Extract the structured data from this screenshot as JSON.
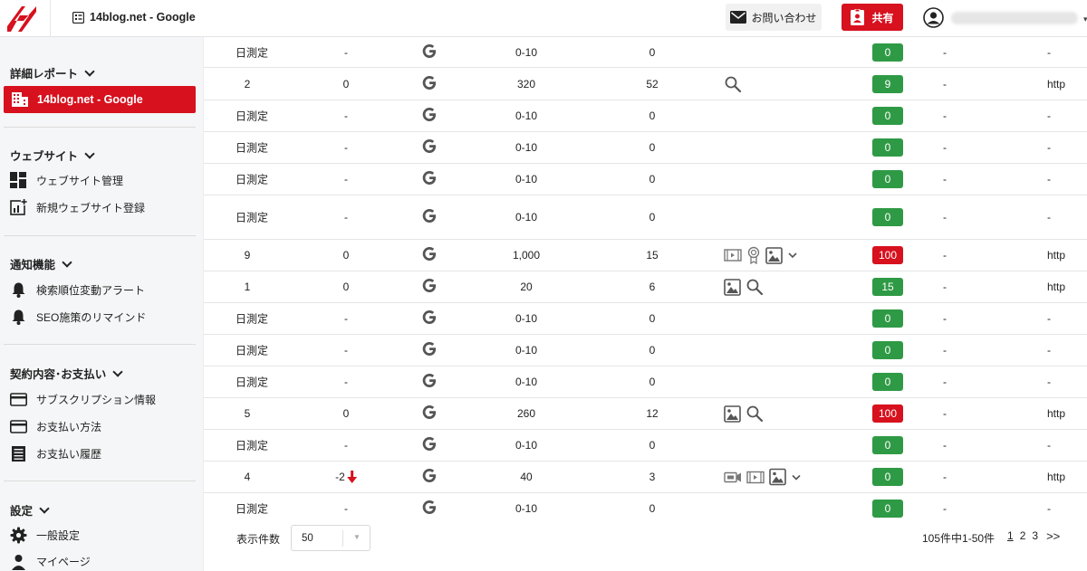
{
  "header": {
    "site_title": "14blog.net - Google",
    "contact_label": "お問い合わせ",
    "share_label": "共有"
  },
  "sidebar": {
    "report_title": "詳細レポート",
    "active_item": "14blog.net - Google",
    "website_title": "ウェブサイト",
    "website_manage": "ウェブサイト管理",
    "website_register": "新規ウェブサイト登録",
    "notify_title": "通知機能",
    "notify_rank_alert": "検索順位変動アラート",
    "notify_seo_remind": "SEO施策のリマインド",
    "contract_title": "契約内容･お支払い",
    "contract_subscription": "サブスクリプション情報",
    "contract_payment_method": "お支払い方法",
    "contract_payment_history": "お支払い履歴",
    "settings_title": "設定",
    "settings_general": "一般設定",
    "settings_mypage": "マイページ"
  },
  "rows": [
    {
      "rank": "日測定",
      "prev": "-",
      "volume": "0-10",
      "count": "0",
      "score": "0",
      "score_color": "#2f9a45",
      "col2": "-",
      "url": "-"
    },
    {
      "rank": "2",
      "prev": "0",
      "volume": "320",
      "count": "52",
      "score": "9",
      "score_color": "#2f9a45",
      "col2": "-",
      "url": "http"
    },
    {
      "rank": "日測定",
      "prev": "-",
      "volume": "0-10",
      "count": "0",
      "score": "0",
      "score_color": "#2f9a45",
      "col2": "-",
      "url": "-"
    },
    {
      "rank": "日測定",
      "prev": "-",
      "volume": "0-10",
      "count": "0",
      "score": "0",
      "score_color": "#2f9a45",
      "col2": "-",
      "url": "-"
    },
    {
      "rank": "日測定",
      "prev": "-",
      "volume": "0-10",
      "count": "0",
      "score": "0",
      "score_color": "#2f9a45",
      "col2": "-",
      "url": "-"
    },
    {
      "rank": "日測定",
      "prev": "-",
      "volume": "0-10",
      "count": "0",
      "score": "0",
      "score_color": "#2f9a45",
      "col2": "-",
      "url": "-"
    },
    {
      "rank": "9",
      "prev": "0",
      "volume": "1,000",
      "count": "15",
      "score": "100",
      "score_color": "#d7111e",
      "col2": "-",
      "url": "http"
    },
    {
      "rank": "1",
      "prev": "0",
      "volume": "20",
      "count": "6",
      "score": "15",
      "score_color": "#2f9a45",
      "col2": "-",
      "url": "http"
    },
    {
      "rank": "日測定",
      "prev": "-",
      "volume": "0-10",
      "count": "0",
      "score": "0",
      "score_color": "#2f9a45",
      "col2": "-",
      "url": "-"
    },
    {
      "rank": "日測定",
      "prev": "-",
      "volume": "0-10",
      "count": "0",
      "score": "0",
      "score_color": "#2f9a45",
      "col2": "-",
      "url": "-"
    },
    {
      "rank": "日測定",
      "prev": "-",
      "volume": "0-10",
      "count": "0",
      "score": "0",
      "score_color": "#2f9a45",
      "col2": "-",
      "url": "-"
    },
    {
      "rank": "5",
      "prev": "0",
      "volume": "260",
      "count": "12",
      "score": "100",
      "score_color": "#d7111e",
      "col2": "-",
      "url": "http"
    },
    {
      "rank": "日測定",
      "prev": "-",
      "volume": "0-10",
      "count": "0",
      "score": "0",
      "score_color": "#2f9a45",
      "col2": "-",
      "url": "-"
    },
    {
      "rank": "4",
      "prev": "-2",
      "volume": "40",
      "count": "3",
      "score": "0",
      "score_color": "#2f9a45",
      "col2": "-",
      "url": "http"
    },
    {
      "rank": "日測定",
      "prev": "-",
      "volume": "0-10",
      "count": "0",
      "score": "0",
      "score_color": "#2f9a45",
      "col2": "-",
      "url": "-"
    }
  ],
  "footer": {
    "per_page_label": "表示件数",
    "per_page_value": "50",
    "count_text": "105件中1-50件",
    "page_1": "1",
    "page_2": "2",
    "page_3": "3",
    "next": ">>"
  },
  "colors": {
    "brand_red": "#d7111e",
    "score_green": "#2f9a45"
  }
}
